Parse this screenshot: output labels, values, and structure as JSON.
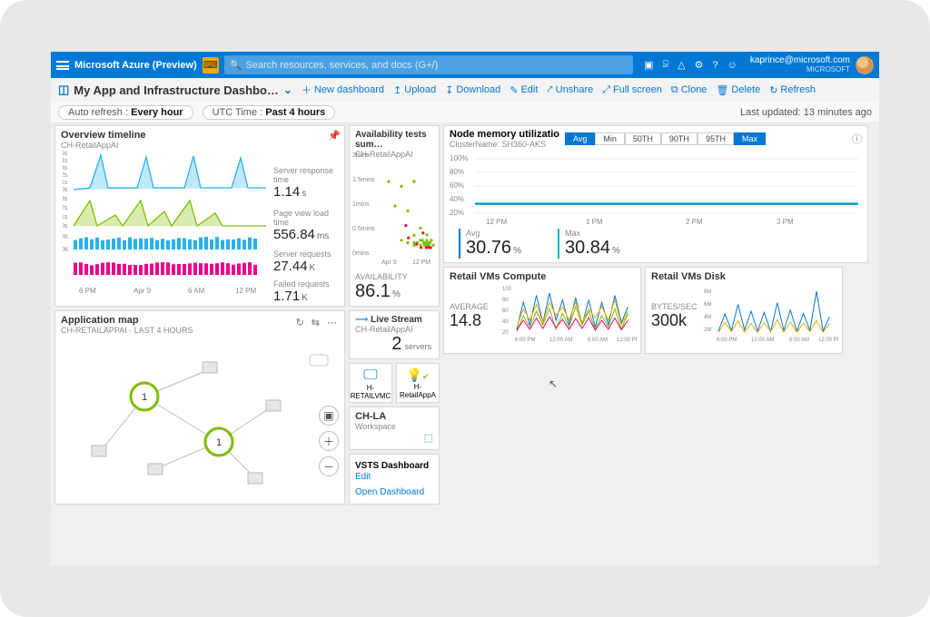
{
  "header": {
    "brand": "Microsoft Azure (Preview)",
    "search_placeholder": "Search resources, services, and docs (G+/)",
    "account_email": "kaprince@microsoft.com",
    "account_org": "MICROSOFT"
  },
  "crumb": {
    "title": "My App and Infrastructure Dashbo…",
    "actions": {
      "new": "New dashboard",
      "upload": "Upload",
      "download": "Download",
      "edit": "Edit",
      "unshare": "Unshare",
      "fullscreen": "Full screen",
      "clone": "Clone",
      "delete": "Delete",
      "refresh": "Refresh"
    }
  },
  "filters": {
    "auto_label": "Auto refresh :",
    "auto_value": "Every hour",
    "utc_label": "UTC Time :",
    "utc_value": "Past 4 hours",
    "last_updated": "Last updated: 13 minutes ago"
  },
  "overview": {
    "title": "Overview timeline",
    "sub": "CH-RetailAppAI",
    "x_ticks": [
      "6 PM",
      "Apr 9",
      "6 AM",
      "12 PM"
    ],
    "stats": {
      "srt_label": "Server response time",
      "srt_value": "1.14",
      "srt_unit": "s",
      "pvl_label": "Page view load time",
      "pvl_value": "556.84",
      "pvl_unit": "ms",
      "req_label": "Server requests",
      "req_value": "27.44",
      "req_unit": "K",
      "fail_label": "Failed requests",
      "fail_value": "1.71",
      "fail_unit": "K"
    }
  },
  "avail": {
    "title": "Availability tests sum…",
    "sub": "CH-RetailAppAI",
    "y_ticks": [
      "2mins",
      "1.5mins",
      "1mins",
      "0.5mins",
      "0mins"
    ],
    "x_ticks": [
      "Apr 9",
      "12 PM"
    ],
    "label": "AVAILABILITY",
    "value": "86.1",
    "unit": "%"
  },
  "nodemem": {
    "title": "Node memory utilizatio",
    "sub": "ClusterName: SH360-AKS",
    "toggles": [
      "Avg",
      "Min",
      "50TH",
      "90TH",
      "95TH",
      "Max"
    ],
    "toggles_on": [
      0,
      5
    ],
    "y_ticks": [
      "100%",
      "80%",
      "60%",
      "40%",
      "20%"
    ],
    "x_ticks": [
      "12 PM",
      "1 PM",
      "2 PM",
      "3 PM"
    ],
    "avg_label": "Avg",
    "avg_value": "30.76",
    "avg_unit": "%",
    "max_label": "Max",
    "max_value": "30.84",
    "max_unit": "%"
  },
  "retail_compute": {
    "title": "Retail VMs Compute",
    "label": "AVERAGE",
    "value": "14.8",
    "y_ticks": [
      "100",
      "80",
      "60",
      "40",
      "20"
    ],
    "x_ticks": [
      "6:00 PM",
      "12:00 AM",
      "6:00 AM",
      "12:00 PM"
    ]
  },
  "retail_disk": {
    "title": "Retail VMs Disk",
    "label": "BYTES/SEC",
    "value": "300k",
    "y_ticks": [
      "8M",
      "6M",
      "4M",
      "2M"
    ],
    "x_ticks": [
      "6:00 PM",
      "12:00 AM",
      "6:00 AM",
      "12:00 PM"
    ]
  },
  "appmap": {
    "title": "Application map",
    "sub": "CH-RETAILAPPAI · LAST 4 HOURS",
    "node_a": "1",
    "node_b": "1"
  },
  "livestream": {
    "title": "Live Stream",
    "sub": "CH-RetailAppAI",
    "value": "2",
    "unit": "servers"
  },
  "small_tiles": {
    "a": "H-RETAILVMC",
    "b": "H-RetailAppA"
  },
  "chla": {
    "title": "CH-LA",
    "sub": "Workspace"
  },
  "vsts": {
    "title": "VSTS Dashboard",
    "edit": "Edit",
    "link": "Open Dashboard"
  },
  "chart_data": [
    {
      "type": "line",
      "name": "server_response_time_s",
      "x_ticks": [
        "6 PM",
        "Apr 9",
        "6 AM",
        "12 PM"
      ],
      "y_ticks": [
        "0s",
        "1s",
        "2s",
        "3s",
        "4s",
        "5s"
      ],
      "values": [
        0.4,
        0.5,
        4.3,
        0.6,
        0.5,
        4.1,
        0.6,
        0.5,
        4.2,
        0.6,
        0.5,
        4.0,
        0.5
      ],
      "color": "#29b1e8"
    },
    {
      "type": "line",
      "name": "page_view_load_time_s",
      "y_ticks": [
        "0s",
        "1s",
        "2s",
        "3s"
      ],
      "values": [
        0.6,
        2.9,
        0.6,
        0.7,
        1.7,
        0.6,
        2.8,
        0.6,
        2.0,
        0.6,
        0.6,
        0.7,
        0.6
      ],
      "color": "#7fbc00"
    },
    {
      "type": "bar",
      "name": "server_requests_k",
      "y_ticks": [
        "0K",
        "2K"
      ],
      "values": [
        2.0,
        2.0,
        2.0,
        2.0,
        2.0,
        2.0,
        2.0,
        2.0,
        2.0,
        2.0,
        2.0,
        2.0,
        2.0,
        2.0,
        2.0,
        2.0,
        2.0,
        2.0,
        2.0,
        2.0,
        2.0,
        2.0,
        2.0,
        2.0
      ],
      "color": "#29b1e8"
    },
    {
      "type": "bar",
      "name": "failed_requests",
      "values": [
        60,
        60,
        60,
        60,
        60,
        60,
        60,
        60,
        60,
        60,
        60,
        60,
        60,
        60,
        60,
        60,
        60,
        60,
        60,
        60,
        60,
        60,
        60,
        60
      ],
      "color": "#ec008c"
    },
    {
      "type": "scatter",
      "name": "availability_tests_duration_min",
      "x_ticks": [
        "Apr 9",
        "12 PM"
      ],
      "y_ticks": [
        "0mins",
        "0.5mins",
        "1mins",
        "1.5mins",
        "2mins"
      ],
      "series": [
        {
          "name": "pass",
          "color": "#7fbc00",
          "x": [
            2,
            3,
            4,
            4,
            5,
            5,
            6,
            6,
            6,
            6,
            6.5,
            7,
            7,
            7,
            7.3,
            7.5,
            7.6,
            7.8,
            8,
            8,
            8,
            8.2,
            8.3,
            8.5,
            8.7,
            9
          ],
          "y": [
            1.5,
            1.0,
            1.4,
            0.3,
            0.9,
            0.25,
            1.5,
            0.4,
            0.25,
            0.2,
            0.25,
            0.55,
            0.3,
            0.2,
            0.3,
            0.25,
            0.2,
            0.25,
            0.41,
            0.3,
            0.2,
            0.25,
            0.2,
            0.25,
            0.3,
            0.2
          ]
        },
        {
          "name": "fail",
          "color": "#e81123",
          "x": [
            4.7,
            5.1,
            6.4,
            7.1,
            7.4,
            7.9,
            8.3,
            8.6
          ],
          "y": [
            0.6,
            0.35,
            0.22,
            0.15,
            0.45,
            0.15,
            0.15,
            0.15
          ]
        }
      ]
    },
    {
      "type": "line",
      "name": "node_memory_util_pct",
      "x_ticks": [
        "12 PM",
        "1 PM",
        "2 PM",
        "3 PM"
      ],
      "ylim": [
        0,
        100
      ],
      "series": [
        {
          "name": "Avg",
          "color": "#0078d4",
          "values": [
            30,
            30,
            30,
            30,
            30,
            30,
            30,
            30
          ]
        },
        {
          "name": "Max",
          "color": "#00b7c3",
          "values": [
            31,
            31,
            31,
            31,
            31,
            31,
            31,
            31
          ]
        }
      ]
    },
    {
      "type": "line",
      "name": "retail_vms_compute_pct",
      "x_ticks": [
        "6:00 PM",
        "12:00 AM",
        "6:00 AM",
        "12:00 PM"
      ],
      "ylim": [
        0,
        100
      ],
      "series": [
        {
          "name": "vm1",
          "color": "#0078d4",
          "values": [
            10,
            70,
            20,
            85,
            25,
            90,
            30,
            75,
            20,
            80,
            20,
            75,
            15,
            70,
            20,
            85,
            25,
            60
          ]
        },
        {
          "name": "vm2",
          "color": "#f2a900",
          "values": [
            15,
            55,
            30,
            65,
            25,
            70,
            40,
            60,
            30,
            70,
            25,
            55,
            35,
            60,
            30,
            75,
            20,
            50
          ]
        },
        {
          "name": "vm3",
          "color": "#7fbc00",
          "values": [
            5,
            40,
            15,
            50,
            20,
            55,
            10,
            45,
            15,
            60,
            20,
            50,
            10,
            40,
            15,
            55,
            10,
            45
          ]
        },
        {
          "name": "vm4",
          "color": "#ec008c",
          "values": [
            8,
            30,
            10,
            35,
            12,
            38,
            14,
            32,
            10,
            34,
            12,
            36,
            8,
            30,
            10,
            35,
            9,
            30
          ]
        }
      ]
    },
    {
      "type": "line",
      "name": "retail_vms_disk_bytes_per_sec",
      "x_ticks": [
        "6:00 PM",
        "12:00 AM",
        "6:00 AM",
        "12:00 PM"
      ],
      "ylim": [
        0,
        8000000
      ],
      "series": [
        {
          "name": "vm1",
          "color": "#0078d4",
          "values": [
            0.5,
            3.5,
            0.6,
            5.2,
            0.7,
            4.0,
            0.5,
            3.8,
            0.4,
            5.5,
            0.6,
            4.2,
            0.5,
            3.6,
            0.6,
            7.5,
            0.5,
            3.0
          ]
        },
        {
          "name": "vm2",
          "color": "#f2a900",
          "values": [
            0.3,
            2.0,
            0.4,
            2.3,
            0.3,
            1.8,
            0.3,
            2.0,
            0.4,
            2.5,
            0.3,
            2.1,
            0.3,
            1.9,
            0.4,
            2.4,
            0.3,
            1.8
          ]
        }
      ]
    }
  ]
}
